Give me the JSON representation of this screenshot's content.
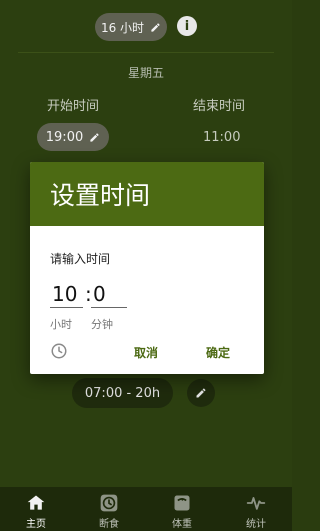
{
  "fasting_chip": {
    "label": "16 小时"
  },
  "day": {
    "label": "星期五"
  },
  "start": {
    "label": "开始时间",
    "value": "19:00"
  },
  "end": {
    "label": "结束时间",
    "value": "11:00"
  },
  "schedule": {
    "value": "07:00 - 20h"
  },
  "dialog": {
    "title": "设置时间",
    "subtitle": "请输入时间",
    "hour_value": "10",
    "minute_value": "0",
    "separator": ":",
    "hour_label": "小时",
    "minute_label": "分钟",
    "cancel": "取消",
    "ok": "确定"
  },
  "nav": [
    {
      "label": "主页",
      "icon": "home-icon"
    },
    {
      "label": "断食",
      "icon": "timer-icon"
    },
    {
      "label": "体重",
      "icon": "scale-icon"
    },
    {
      "label": "统计",
      "icon": "pulse-icon"
    }
  ],
  "colors": {
    "primary": "#4c6a13",
    "scrim_bg": "#2c3f10",
    "nav_bg": "#1e2a0b"
  }
}
